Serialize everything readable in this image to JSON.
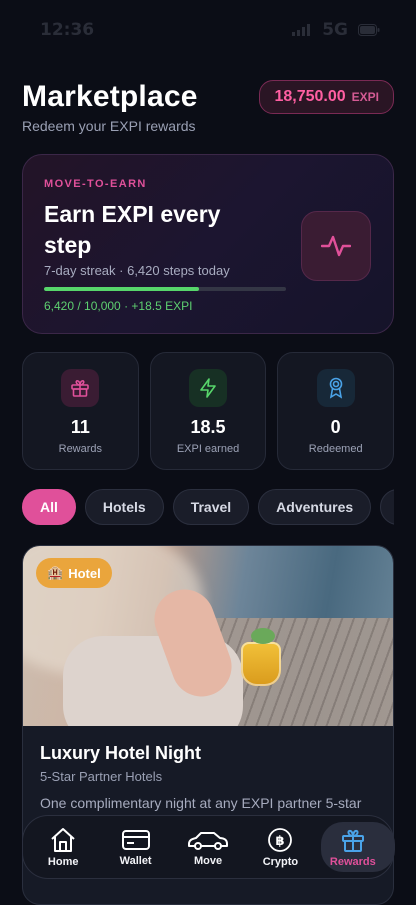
{
  "status_bar": {
    "time": "12:36",
    "carrier": "5G"
  },
  "header": {
    "title": "Marketplace",
    "subtitle": "Redeem your EXPI rewards",
    "balance_amount": "18,750.00",
    "balance_unit": "EXPI"
  },
  "move_to_earn": {
    "eyebrow": "MOVE-TO-EARN",
    "headline": "Earn EXPI every step",
    "streak_text": "7-day streak · 6,420 steps today",
    "progress_fraction": 0.642,
    "progress_label": "6,420 / 10,000 · +18.5 EXPI",
    "icon": "activity-pulse-icon"
  },
  "stats": [
    {
      "value": "11",
      "label": "Rewards",
      "icon": "gift-icon",
      "color": "#e0509a"
    },
    {
      "value": "18.5",
      "label": "EXPI earned",
      "icon": "bolt-icon",
      "color": "#57d66b"
    },
    {
      "value": "0",
      "label": "Redeemed",
      "icon": "award-icon",
      "color": "#4aa3e8"
    }
  ],
  "filters": [
    "All",
    "Hotels",
    "Travel",
    "Adventures",
    ""
  ],
  "active_filter": "All",
  "reward_card": {
    "badge": "Hotel",
    "badge_icon": "hotel-emoji-icon",
    "name": "Luxury Hotel Night",
    "partner": "5-Star Partner Hotels",
    "description": "One complimentary night at any EXPI partner 5-star"
  },
  "nav": [
    {
      "label": "Home",
      "icon": "home-icon"
    },
    {
      "label": "Wallet",
      "icon": "wallet-icon"
    },
    {
      "label": "Move",
      "icon": "car-icon"
    },
    {
      "label": "Crypto",
      "icon": "bitcoin-icon"
    },
    {
      "label": "Rewards",
      "icon": "gift-icon"
    }
  ],
  "active_nav": "Rewards",
  "colors": {
    "accent": "#e0509a",
    "success": "#57d66b",
    "info": "#4aa3e8",
    "badge": "#eaa53c",
    "background": "#0b0d16"
  }
}
